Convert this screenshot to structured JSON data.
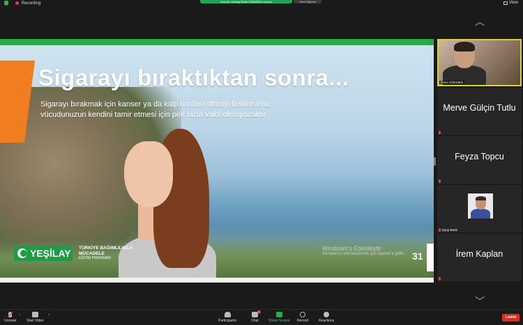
{
  "topbar": {
    "recording_label": "Recording",
    "banner_text": "You are viewing Ömer KÖKMEN's screen",
    "view_options_label": "View Options",
    "view_label": "View"
  },
  "slide": {
    "title": "Sigarayı bıraktıktan sonra...",
    "subtitle": "Sigarayı bırakmak için kanser ya da kalp hastası olmayı beklerseniz, vücudunuzun kendini tamir etmesi için pek fazla vakti olmayacaktır.",
    "logo_text": "YEŞİLAY",
    "program_line1": "TÜRKİYE BAĞIMLILIKLA",
    "program_line2": "MÜCADELE",
    "program_line3": "EĞİTİM PROGRAMI",
    "windows_activate_title": "Windows'u Etkinleştir",
    "windows_activate_sub": "Windows'u etkinleştirmek için Ayarlar'a gidin.",
    "page_number": "31"
  },
  "participants": [
    {
      "name": "Ömer KÖKMEN",
      "type": "video"
    },
    {
      "name": "Merve Gülçin Tutlu",
      "type": "name"
    },
    {
      "name": "Feyza Topcu",
      "type": "name"
    },
    {
      "name": "Eyüp Benk",
      "type": "avatar"
    },
    {
      "name": "İrem Kaplan",
      "type": "name"
    }
  ],
  "toolbar": {
    "unmute": "Unmute",
    "start_video": "Start Video",
    "participants": "Participants",
    "participants_count": "9",
    "chat": "Chat",
    "chat_badge": "1",
    "share_screen": "Share Screen",
    "record": "Record",
    "reactions": "Reactions",
    "leave": "Leave"
  },
  "colors": {
    "brand_green": "#2aa84a",
    "leave_red": "#e02b2b",
    "active_speaker": "#d6d62a",
    "slide_orange": "#f07d22"
  }
}
